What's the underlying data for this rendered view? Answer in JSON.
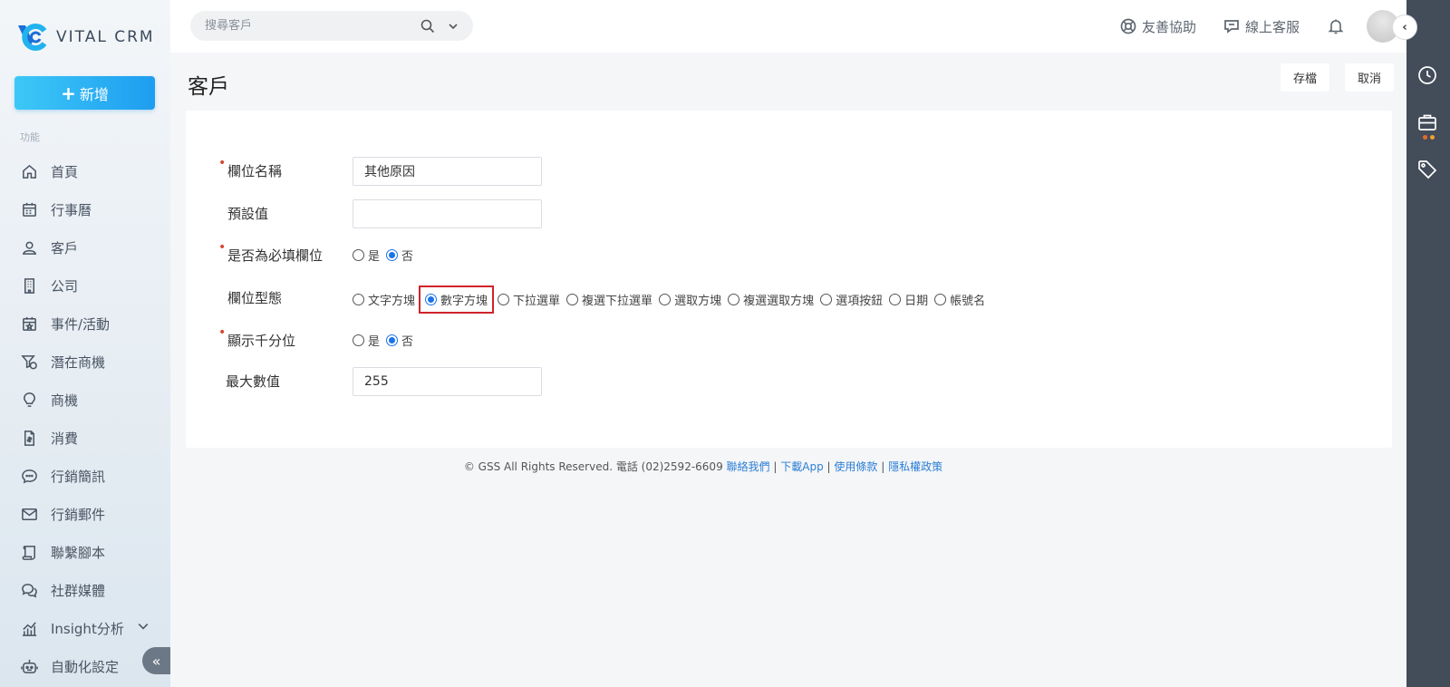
{
  "app": {
    "brand": "VITAL CRM"
  },
  "sidebar": {
    "new_button": "新增",
    "section_label": "功能",
    "items": [
      {
        "label": "首頁",
        "icon": "home-icon"
      },
      {
        "label": "行事曆",
        "icon": "calendar-icon"
      },
      {
        "label": "客戶",
        "icon": "user-icon"
      },
      {
        "label": "公司",
        "icon": "building-icon"
      },
      {
        "label": "事件/活動",
        "icon": "event-calendar-icon"
      },
      {
        "label": "潛在商機",
        "icon": "funnel-dollar-icon"
      },
      {
        "label": "商機",
        "icon": "lightbulb-icon"
      },
      {
        "label": "消費",
        "icon": "receipt-icon"
      },
      {
        "label": "行銷簡訊",
        "icon": "chat-sms-icon"
      },
      {
        "label": "行銷郵件",
        "icon": "mail-icon"
      },
      {
        "label": "聯繫腳本",
        "icon": "script-icon"
      },
      {
        "label": "社群媒體",
        "icon": "comments-icon"
      },
      {
        "label": "Insight分析",
        "icon": "chart-icon"
      },
      {
        "label": "自動化設定",
        "icon": "robot-icon"
      }
    ]
  },
  "topbar": {
    "search_placeholder": "搜尋客戶",
    "help_label": "友善協助",
    "support_label": "線上客服"
  },
  "main": {
    "title": "客戶",
    "save_button": "存檔",
    "cancel_button": "取消",
    "form": {
      "field_name_label": "欄位名稱",
      "field_name_value": "其他原因",
      "default_value_label": "預設值",
      "default_value_value": "",
      "required_label": "是否為必填欄位",
      "required_options": [
        "是",
        "否"
      ],
      "required_selected": "否",
      "type_label": "欄位型態",
      "type_options": [
        "文字方塊",
        "數字方塊",
        "下拉選單",
        "複選下拉選單",
        "選取方塊",
        "複選選取方塊",
        "選項按鈕",
        "日期",
        "帳號名"
      ],
      "type_selected": "數字方塊",
      "thousands_label": "顯示千分位",
      "thousands_options": [
        "是",
        "否"
      ],
      "thousands_selected": "否",
      "max_label": "最大數值",
      "max_value": "255"
    }
  },
  "footer": {
    "text": "© GSS All Rights Reserved. 電話 (02)2592-6609",
    "links": [
      "聯絡我們",
      "下載App",
      "使用條款",
      "隱私權政策"
    ],
    "separator": "|"
  },
  "colors": {
    "accent": "#1a73e8",
    "highlight_box": "#d1232a",
    "rail_bg": "#434c59",
    "required_mark": "#d9462f"
  }
}
